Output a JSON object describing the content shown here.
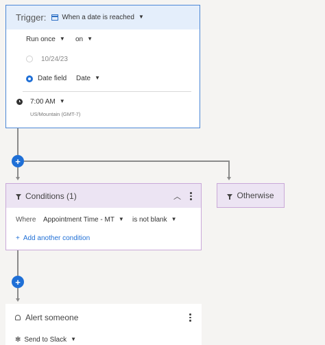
{
  "trigger": {
    "label": "Trigger:",
    "value": "When a date is reached",
    "frequency": "Run once",
    "preposition": "on",
    "date_option_value": "10/24/23",
    "date_field_label": "Date field",
    "date_field_value": "Date",
    "time": "7:00 AM",
    "timezone": "US/Mountain (GMT-7)"
  },
  "conditions": {
    "title": "Conditions (1)",
    "where_label": "Where",
    "field": "Appointment Time - MT",
    "operator": "is not blank",
    "add_label": "Add another condition"
  },
  "otherwise": {
    "label": "Otherwise"
  },
  "alert": {
    "title": "Alert someone",
    "action": "Send to Slack"
  },
  "buttons": {
    "plus": "+"
  },
  "colors": {
    "accent": "#1f6fd6",
    "trigger_border": "#4a86d6",
    "trigger_header": "#e4eefb",
    "condition_border": "#c9a8d8",
    "condition_header": "#ece4f3"
  }
}
